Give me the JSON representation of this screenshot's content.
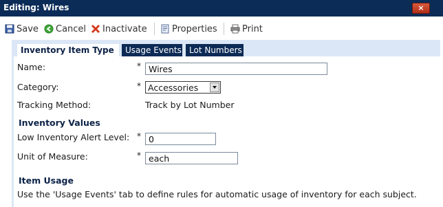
{
  "window": {
    "title": "Editing: Wires",
    "close_glyph": "×"
  },
  "toolbar": {
    "save": "Save",
    "cancel": "Cancel",
    "inactivate": "Inactivate",
    "properties": "Properties",
    "print": "Print",
    "icons": [
      "floppy-save-icon",
      "green-circle-cancel-icon",
      "red-x-icon",
      "document-properties-icon",
      "printer-icon"
    ]
  },
  "tabs": [
    {
      "label": "Inventory Item Type",
      "active": true
    },
    {
      "label": "Usage Events",
      "active": false
    },
    {
      "label": "Lot Numbers",
      "active": false
    }
  ],
  "form": {
    "required_mark": "*",
    "name_label": "Name:",
    "name_value": "Wires",
    "category_label": "Category:",
    "category_value": "Accessories",
    "tracking_label": "Tracking Method:",
    "tracking_value": "Track by Lot Number",
    "inventory_section": "Inventory Values",
    "low_alert_label": "Low Inventory Alert Level:",
    "low_alert_value": "0",
    "unit_label": "Unit of Measure:",
    "unit_value": "each",
    "usage_section": "Item Usage",
    "usage_text": "Use the 'Usage Events' tab to define rules for automatic usage of inventory for each subject."
  },
  "colors": {
    "titlebar": "#0b2c57",
    "panel": "#dbe7f6",
    "tab_inactive": "#0c2a55"
  }
}
